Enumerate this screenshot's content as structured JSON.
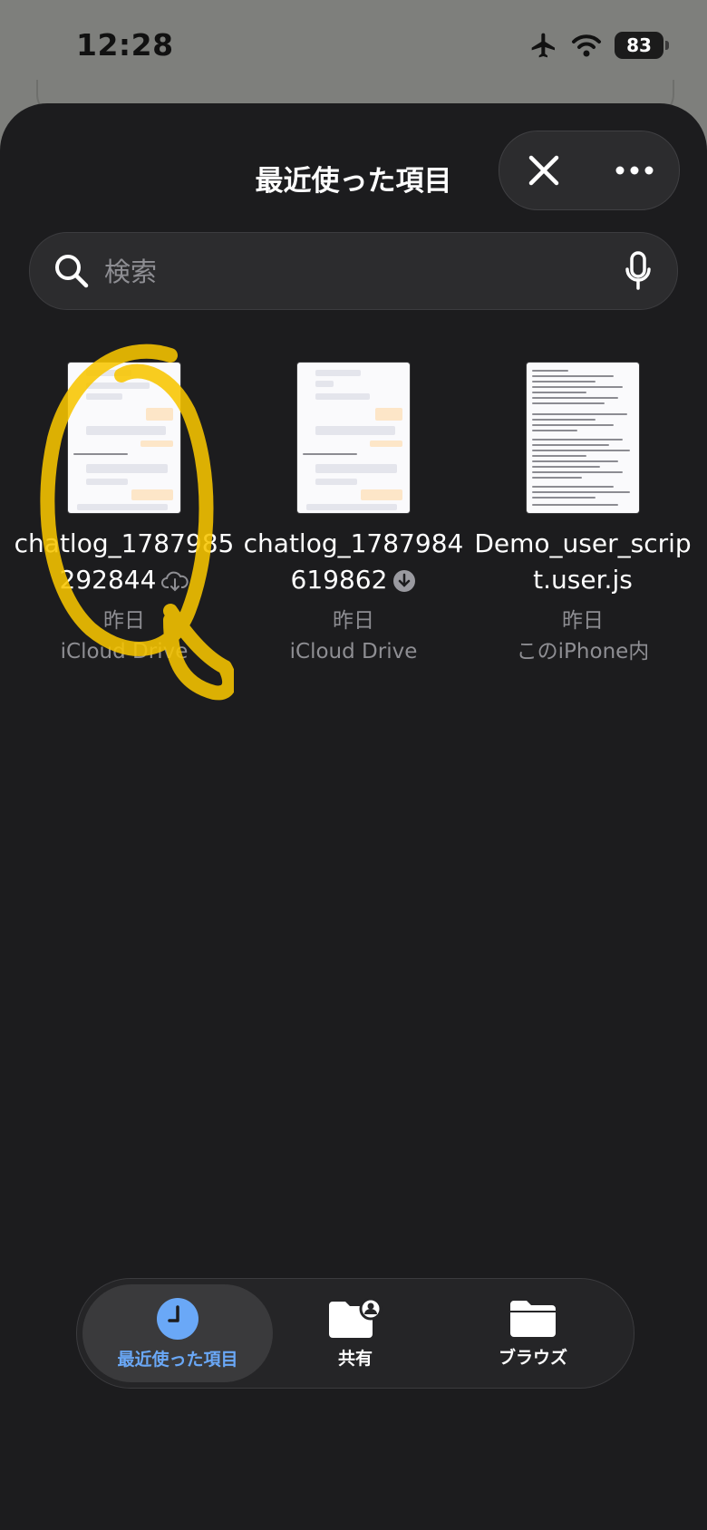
{
  "status_bar": {
    "time": "12:28",
    "battery": "83",
    "icons": [
      "airplane-icon",
      "wifi-icon",
      "battery-icon"
    ]
  },
  "sheet": {
    "title": "最近使った項目",
    "close_icon": "close-icon",
    "more_icon": "more-icon"
  },
  "search": {
    "placeholder": "検索",
    "value": ""
  },
  "files": [
    {
      "name": "chatlog_1787985292844",
      "date": "昨日",
      "location": "iCloud Drive",
      "status_icon": "icloud-download-icon"
    },
    {
      "name": "chatlog_1787984619862",
      "date": "昨日",
      "location": "iCloud Drive",
      "status_icon": "downloading-icon"
    },
    {
      "name": "Demo_user_script.user.js",
      "date": "昨日",
      "location": "このiPhone内",
      "status_icon": ""
    }
  ],
  "tabs": [
    {
      "label": "最近使った項目",
      "icon": "clock-icon",
      "active": true
    },
    {
      "label": "共有",
      "icon": "shared-folder-icon",
      "active": false
    },
    {
      "label": "ブラウズ",
      "icon": "folder-icon",
      "active": false
    }
  ],
  "colors": {
    "sheet_bg": "#1c1c1e",
    "accent": "#6aa8f7",
    "annotation": "#f7c500"
  }
}
